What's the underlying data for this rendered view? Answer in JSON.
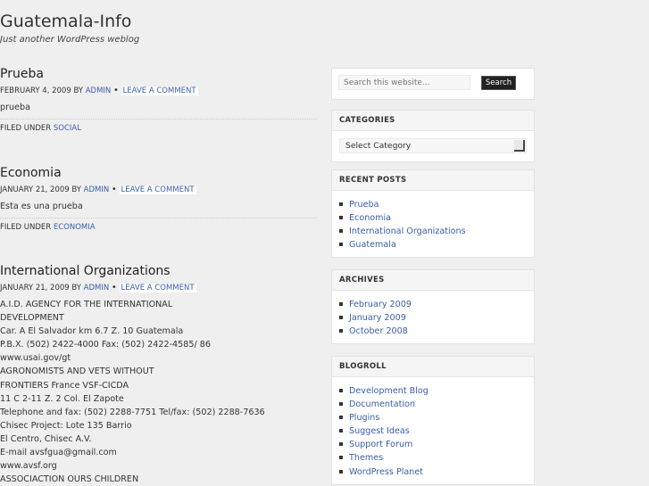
{
  "header": {
    "title": "Guatemala-Info",
    "tagline": "Just another WordPress weblog"
  },
  "posts": [
    {
      "title": "Prueba",
      "date": "February 4, 2009",
      "by": "by",
      "author": "admin",
      "comment_link": "Leave a Comment",
      "body": [
        "prueba"
      ],
      "filed_label": "Filed Under",
      "category": "Social"
    },
    {
      "title": "Economia",
      "date": "January 21, 2009",
      "by": "by",
      "author": "admin",
      "comment_link": "Leave a Comment",
      "body": [
        "Esta es una prueba"
      ],
      "filed_label": "Filed Under",
      "category": "Economia"
    },
    {
      "title": "International Organizations",
      "date": "January 21, 2009",
      "by": "by",
      "author": "admin",
      "comment_link": "Leave a Comment",
      "body": [
        "A.I.D. AGENCY FOR THE INTERNATIONAL",
        "DEVELOPMENT",
        "Car. A El Salvador km 6.7 Z. 10 Guatemala",
        "P.B.X. (502) 2422-4000 Fax: (502) 2422-4585/ 86",
        "www.usai.gov/gt",
        "AGRONOMISTS AND VETS WITHOUT",
        "FRONTIERS France VSF-CICDA",
        "11 C 2-11 Z. 2 Col. El Zapote",
        "Telephone and fax: (502) 2288-7751 Tel/fax: (502) 2288-7636",
        "Chisec Project: Lote 135 Barrio",
        "El Centro, Chisec A.V.",
        "E-mail avsfgua@gmail.com",
        "www.avsf.org",
        "ASSOCIACTION OURS CHILDREN"
      ]
    }
  ],
  "sidebar": {
    "search": {
      "placeholder": "Search this website...",
      "button": "Search"
    },
    "categories": {
      "title": "CATEGORIES",
      "selected": "Select Category"
    },
    "recent": {
      "title": "RECENT POSTS",
      "items": [
        "Prueba",
        "Economia",
        "International Organizations",
        "Guatemala"
      ]
    },
    "archives": {
      "title": "ARCHIVES",
      "items": [
        "February 2009",
        "January 2009",
        "October 2008"
      ]
    },
    "blogroll": {
      "title": "BLOGROLL",
      "items": [
        "Development Blog",
        "Documentation",
        "Plugins",
        "Suggest Ideas",
        "Support Forum",
        "Themes",
        "WordPress Planet"
      ]
    }
  },
  "colors": {
    "link": "#3a5ea8",
    "background": "#efefef",
    "button": "#222222"
  }
}
